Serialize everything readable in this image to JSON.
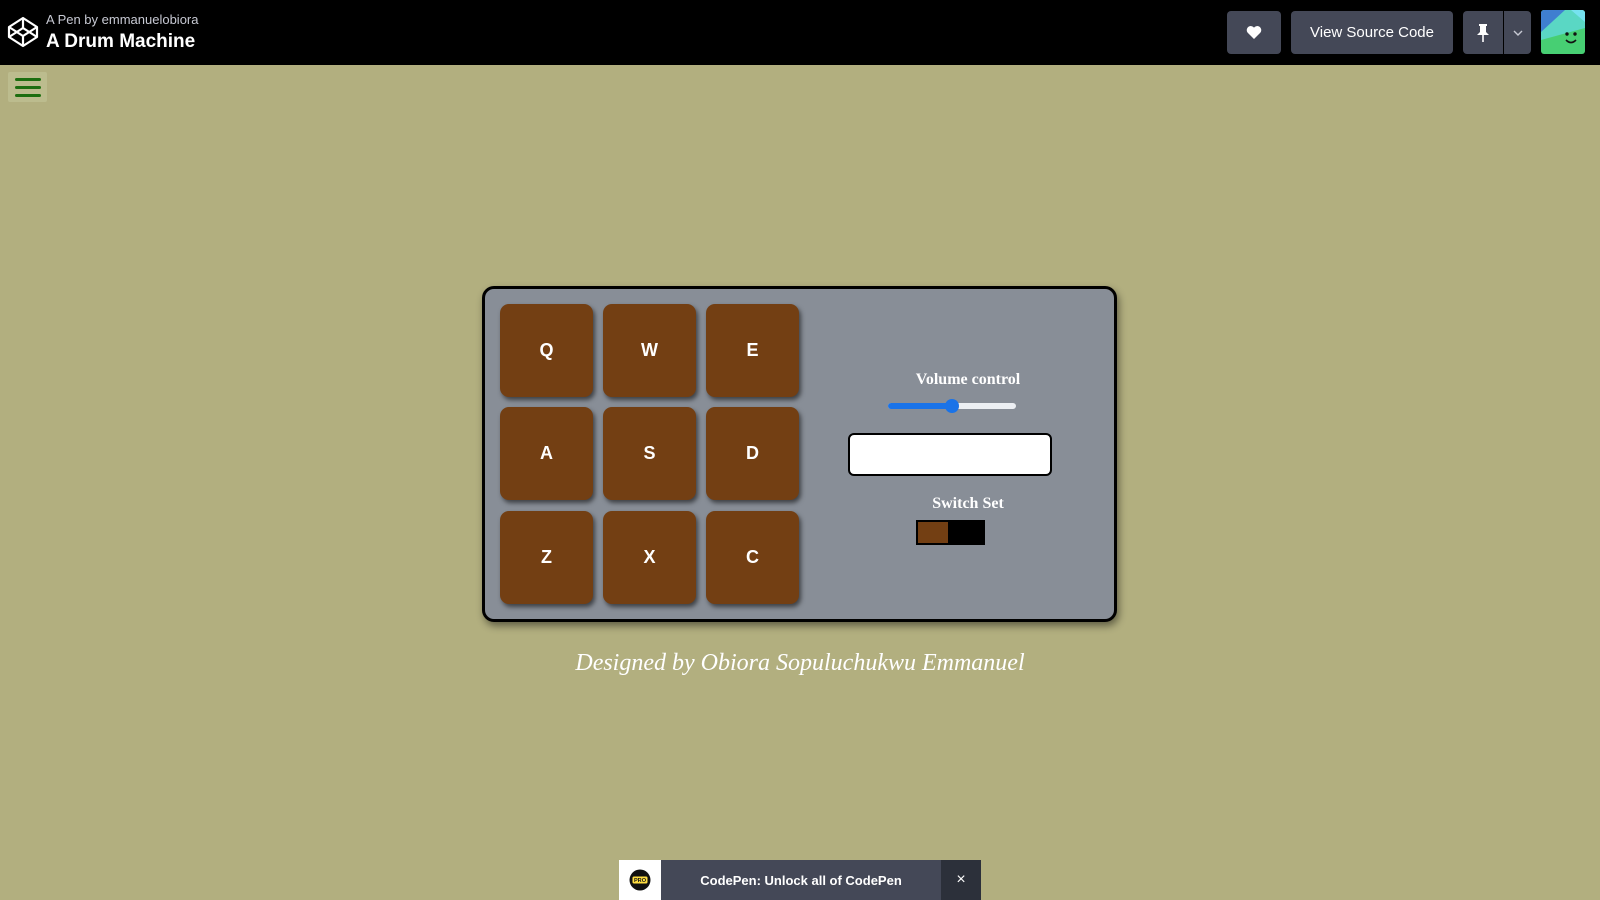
{
  "header": {
    "byline": "A Pen by emmanuelobiora",
    "title": "A Drum Machine",
    "view_source_label": "View Source Code",
    "icons": [
      "codepen-logo-icon",
      "heart-icon",
      "pin-icon",
      "chevron-down-icon",
      "user-avatar"
    ]
  },
  "page": {
    "menu_icon": "hamburger-menu-icon"
  },
  "drum_machine": {
    "pads": [
      "Q",
      "W",
      "E",
      "A",
      "S",
      "D",
      "Z",
      "X",
      "C"
    ],
    "volume_label": "Volume control",
    "volume_level": 0.5,
    "display_text": "",
    "switch_label": "Switch Set",
    "switch_state": "off"
  },
  "credit": "Designed by Obiora Sopuluchukwu Emmanuel",
  "promo": {
    "badge": "PRO",
    "text": "CodePen: Unlock all of CodePen",
    "close": "×"
  },
  "colors": {
    "page_background": "#b2af7f",
    "machine_background": "#888e97",
    "pad": "#733f13",
    "slider_accent": "#1a73e8",
    "menu_icon": "#1d6e10",
    "header_button": "#444857"
  }
}
